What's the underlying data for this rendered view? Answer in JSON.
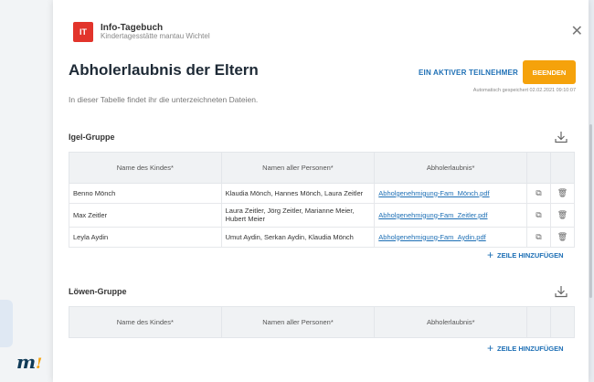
{
  "app": {
    "badge": "IT",
    "title": "Info-Tagebuch",
    "subtitle": "Kindertagesstätte mantau Wichtel",
    "close": "✕"
  },
  "page": {
    "title": "Abholerlaubnis der Eltern",
    "subtitle": "In dieser Tabelle findet ihr die unterzeichneten Dateien.",
    "participants_link": "EIN AKTIVER TEILNEHMER",
    "end_button": "BEENDEN",
    "autosave": "Automatisch gespeichert 02.02.2021 09:10:07"
  },
  "columns": [
    "Name des Kindes*",
    "Namen aller Personen*",
    "Abholerlaubnis*"
  ],
  "groups": [
    {
      "title": "Igel-Gruppe",
      "rows": [
        {
          "child": "Benno Mönch",
          "persons": "Klaudia Mönch, Hannes Mönch, Laura Zeitler",
          "file": "Abholgenehmigung-Fam_Mönch.pdf"
        },
        {
          "child": "Max Zeitler",
          "persons": "Laura Zeitler, Jörg Zeitler, Marianne Meier, Hubert Meier",
          "file": "Abholgenehmigung-Fam_Zeitler.pdf"
        },
        {
          "child": "Leyla Aydin",
          "persons": "Umut Aydin, Serkan Aydin, Klaudia Mönch",
          "file": "Abholgenehmigung-Fam_Aydin.pdf"
        }
      ],
      "add_label": "ZEILE HINZUFÜGEN"
    },
    {
      "title": "Löwen-Gruppe",
      "rows": [],
      "add_label": "ZEILE HINZUFÜGEN"
    }
  ],
  "icons": {
    "download": "download-icon",
    "copy": "copy-icon",
    "delete": "trash-icon",
    "add": "plus-icon"
  },
  "colors": {
    "accent": "#1d6fb5",
    "end_button": "#f5a20b",
    "badge": "#e2342b"
  }
}
